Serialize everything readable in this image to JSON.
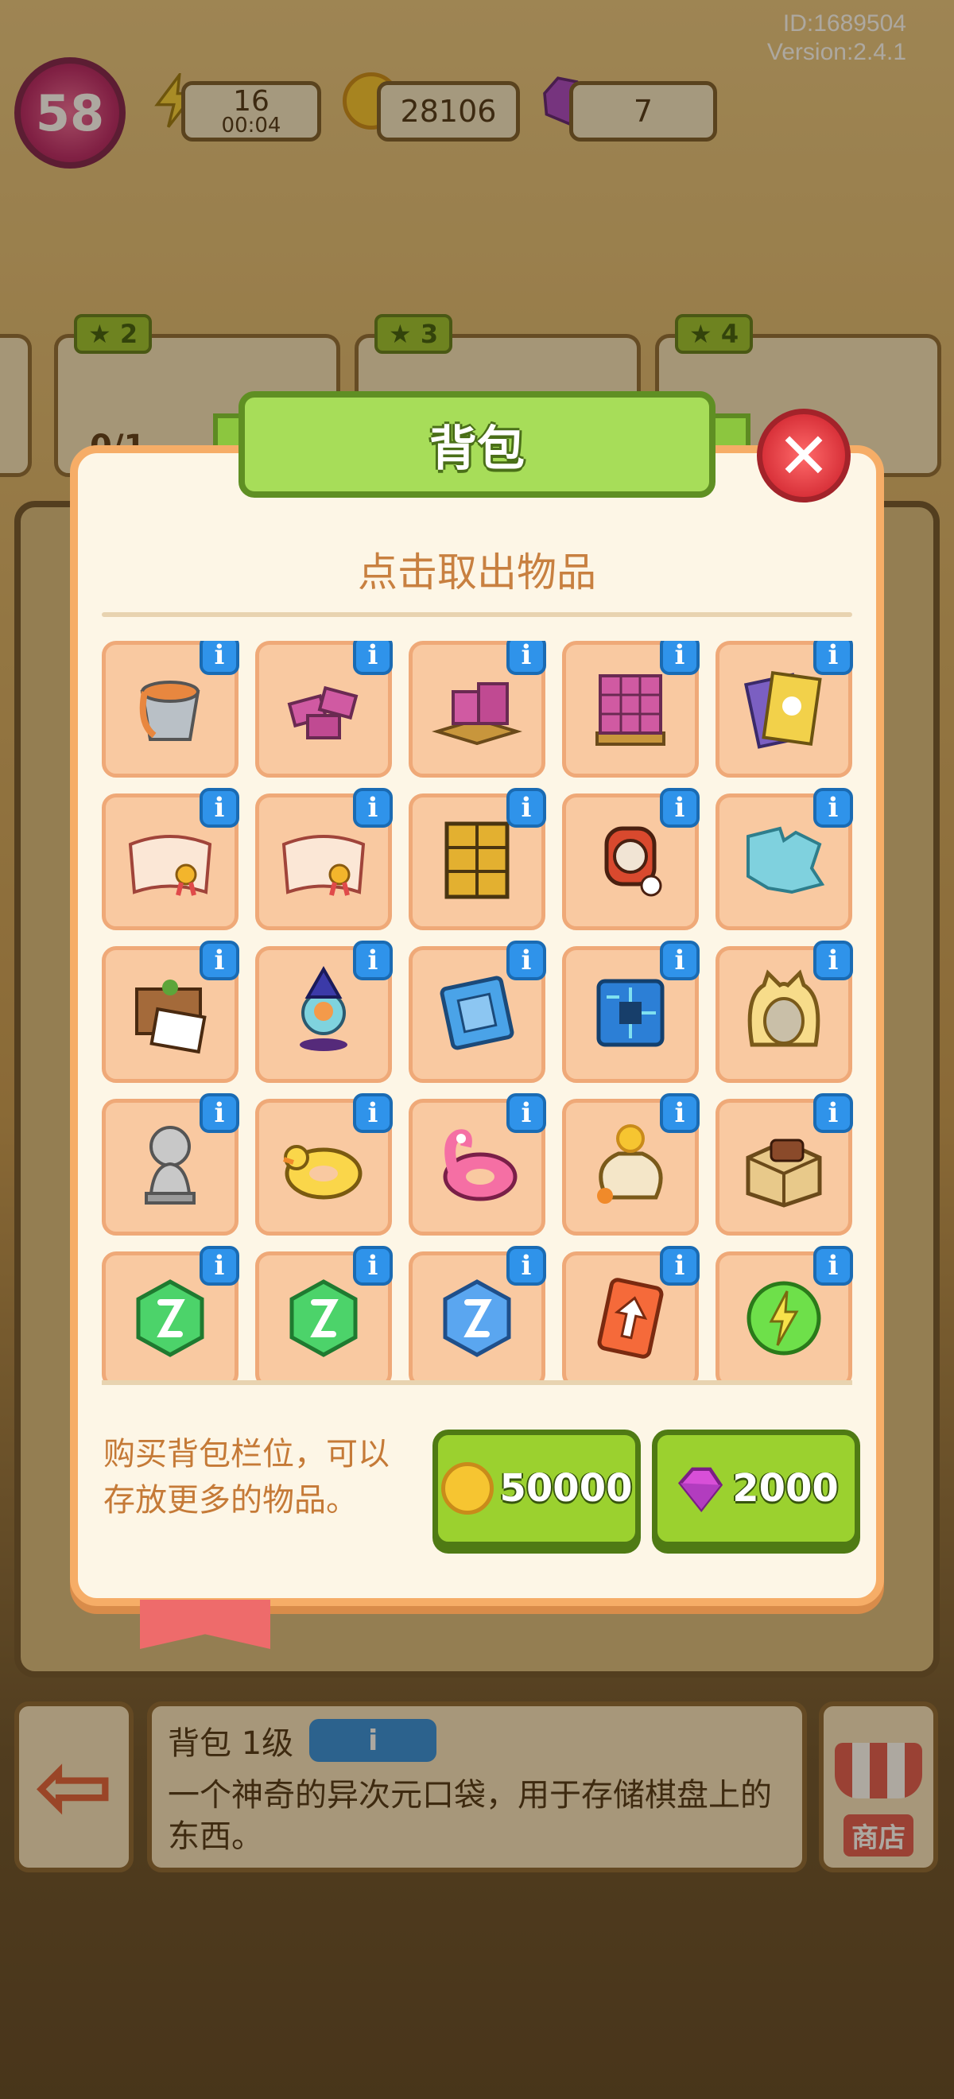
{
  "hud": {
    "id_label": "ID:1689504",
    "version_label": "Version:2.4.1",
    "level": "58",
    "energy": "16",
    "energy_timer": "00:04",
    "coins": "28106",
    "gems": "7"
  },
  "tasks": [
    {
      "stars": "2",
      "count": "0/1"
    },
    {
      "stars": "3",
      "count": ""
    },
    {
      "stars": "4",
      "count": ""
    }
  ],
  "modal": {
    "title": "背包",
    "subtitle": "点击取出物品",
    "buy_text": "购买背包栏位，可以存放更多的物品。",
    "buy_coin_price": "50000",
    "buy_gem_price": "2000",
    "info_glyph": "i",
    "close_glyph": "✕",
    "items": [
      {
        "icon": "bucket-icon"
      },
      {
        "icon": "bricks-icon"
      },
      {
        "icon": "brick-pile-icon"
      },
      {
        "icon": "brick-pallet-icon"
      },
      {
        "icon": "books-icon"
      },
      {
        "icon": "certificate-icon"
      },
      {
        "icon": "certificate-icon"
      },
      {
        "icon": "cabinet-icon"
      },
      {
        "icon": "smartwatch-icon"
      },
      {
        "icon": "puzzle-icon"
      },
      {
        "icon": "photo-scrapbook-icon"
      },
      {
        "icon": "wizard-figurine-icon"
      },
      {
        "icon": "cpu-icon"
      },
      {
        "icon": "circuit-board-icon"
      },
      {
        "icon": "cat-hood-icon"
      },
      {
        "icon": "statue-icon"
      },
      {
        "icon": "duck-float-icon"
      },
      {
        "icon": "flamingo-float-icon"
      },
      {
        "icon": "money-sack-icon"
      },
      {
        "icon": "parcel-box-icon"
      },
      {
        "icon": "green-hourglass-gem-icon"
      },
      {
        "icon": "green-hourglass-gem-icon"
      },
      {
        "icon": "blue-hourglass-gem-icon"
      },
      {
        "icon": "upgrade-card-icon"
      },
      {
        "icon": "energy-orb-icon"
      }
    ]
  },
  "info_bar": {
    "title": "背包 1级",
    "description": "一个神奇的异次元口袋，用于存储棋盘上的东西。",
    "shop_label": "商店"
  },
  "colors": {
    "modal_border": "#f6ad67",
    "slot_bg": "#f9c9a1",
    "banner_green": "#a7dd59",
    "button_green": "#9bd12f",
    "info_blue": "#2f93ea",
    "close_red": "#d9323a"
  }
}
